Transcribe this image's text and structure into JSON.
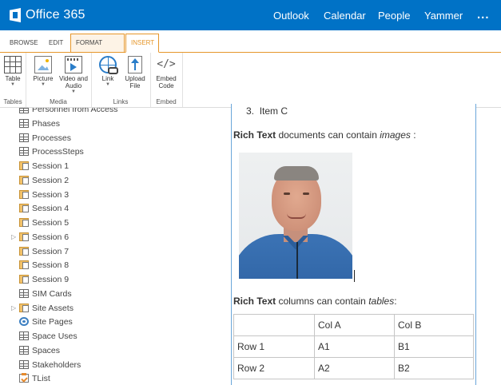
{
  "suite": {
    "brand": "Office 365",
    "links": [
      "Outlook",
      "Calendar",
      "People",
      "Yammer"
    ],
    "more": "..."
  },
  "ribbon": {
    "tabs": [
      "BROWSE",
      "EDIT",
      "FORMAT TEXT",
      "INSERT"
    ],
    "active_tab": "INSERT",
    "groups": {
      "tables": {
        "name": "Tables",
        "table": "Table"
      },
      "media": {
        "name": "Media",
        "picture": "Picture",
        "video_line1": "Video and",
        "video_line2": "Audio"
      },
      "links": {
        "name": "Links",
        "link": "Link",
        "upload_line1": "Upload",
        "upload_line2": "File"
      },
      "embed": {
        "name": "Embed",
        "embed_line1": "Embed",
        "embed_line2": "Code"
      }
    },
    "accent_color": "#e6962a"
  },
  "nav": {
    "items": [
      {
        "label": "Personnel from Access",
        "icon": "list-icon"
      },
      {
        "label": "Phases",
        "icon": "list-icon"
      },
      {
        "label": "Processes",
        "icon": "list-icon"
      },
      {
        "label": "ProcessSteps",
        "icon": "list-icon"
      },
      {
        "label": "Session 1",
        "icon": "library-icon"
      },
      {
        "label": "Session 2",
        "icon": "library-icon"
      },
      {
        "label": "Session 3",
        "icon": "library-icon"
      },
      {
        "label": "Session 4",
        "icon": "library-icon"
      },
      {
        "label": "Session 5",
        "icon": "library-icon"
      },
      {
        "label": "Session 6",
        "icon": "library-icon",
        "expandable": true
      },
      {
        "label": "Session 7",
        "icon": "library-icon"
      },
      {
        "label": "Session 8",
        "icon": "library-icon"
      },
      {
        "label": "Session 9",
        "icon": "library-icon"
      },
      {
        "label": "SIM Cards",
        "icon": "list-icon"
      },
      {
        "label": "Site Assets",
        "icon": "library-icon",
        "expandable": true
      },
      {
        "label": "Site Pages",
        "icon": "gear-icon"
      },
      {
        "label": "Space Uses",
        "icon": "list-icon"
      },
      {
        "label": "Spaces",
        "icon": "list-icon"
      },
      {
        "label": "Stakeholders",
        "icon": "list-icon"
      },
      {
        "label": "TList",
        "icon": "task-icon"
      }
    ]
  },
  "editor": {
    "list_item": "Item C",
    "list_number": "3.",
    "images_sentence": {
      "bold": "Rich Text",
      "middle": " documents can contain ",
      "italic": "images",
      "end": " :"
    },
    "tables_sentence": {
      "bold": "Rich Text",
      "middle": " columns can contain ",
      "italic": "tables",
      "end": ":"
    },
    "table": {
      "header": [
        "",
        "Col A",
        "Col B"
      ],
      "rows": [
        [
          "Row 1",
          "A1",
          "B1"
        ],
        [
          "Row 2",
          "A2",
          "B2"
        ]
      ]
    }
  },
  "colors": {
    "suite_bar": "#0072c6",
    "editor_border": "#6aa6da"
  }
}
